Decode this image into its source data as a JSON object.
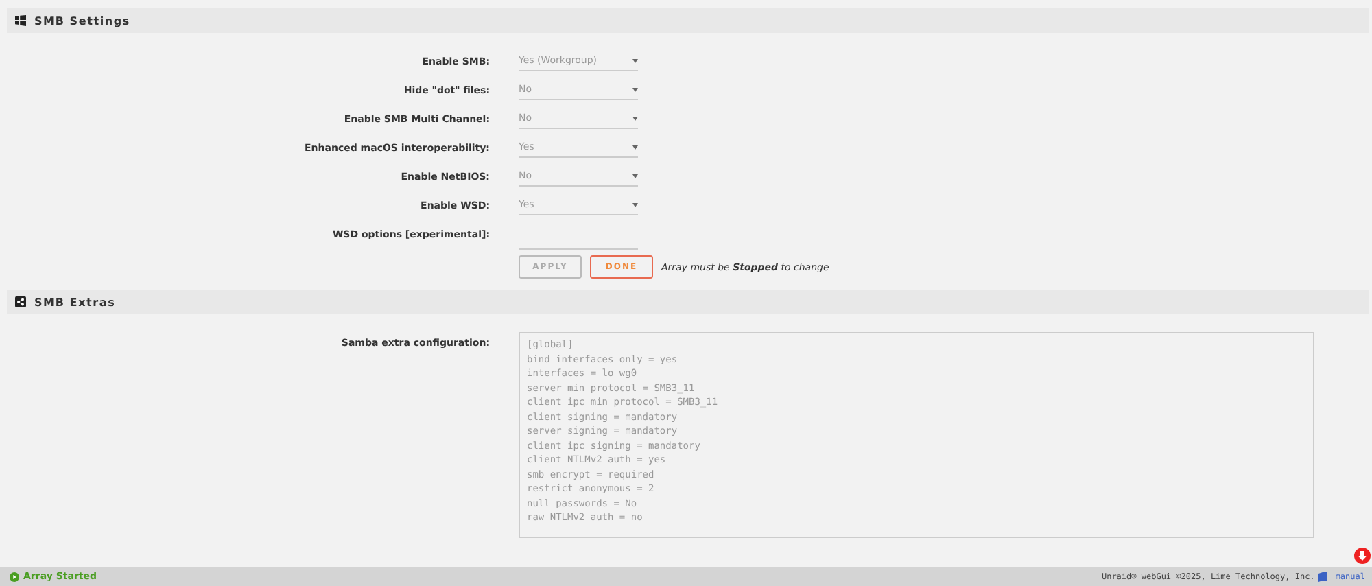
{
  "sections": [
    {
      "title": "SMB Settings",
      "fields": [
        {
          "kind": "select",
          "label": "Enable SMB:",
          "value": "Yes (Workgroup)",
          "disabled": true
        },
        {
          "kind": "select",
          "label": "Hide \"dot\" files:",
          "value": "No",
          "disabled": true
        },
        {
          "kind": "select",
          "label": "Enable SMB Multi Channel:",
          "value": "No",
          "disabled": true
        },
        {
          "kind": "select",
          "label": "Enhanced macOS interoperability:",
          "value": "Yes",
          "disabled": true
        },
        {
          "kind": "select",
          "label": "Enable NetBIOS:",
          "value": "No",
          "disabled": true
        },
        {
          "kind": "select",
          "label": "Enable WSD:",
          "value": "Yes",
          "disabled": true
        },
        {
          "kind": "text",
          "label": "WSD options [experimental]:",
          "disabled": true
        }
      ],
      "buttons": [
        {
          "label": "APPLY",
          "disabled": true
        },
        {
          "label": "DONE",
          "disabled": false
        }
      ],
      "note": "Array must be **Stopped** to change"
    },
    {
      "title": "SMB Extras",
      "fields": [
        {
          "kind": "textarea",
          "label": "Samba extra configuration:",
          "disabled": true,
          "lines": [
            "[global]",
            "bind interfaces only = yes",
            "interfaces = lo wg0",
            "server min protocol = SMB3_11",
            "client ipc min protocol = SMB3_11",
            "client signing = mandatory",
            "server signing = mandatory",
            "client ipc signing = mandatory",
            "client NTLMv2 auth = yes",
            "smb encrypt = required",
            "restrict anonymous = 2",
            "null passwords = No",
            "raw NTLMv2 auth = no"
          ]
        }
      ]
    }
  ],
  "status_bar": {
    "status": "Array Started",
    "started": true,
    "copyright": "Unraid® webGui ©2025, Lime Technology, Inc.",
    "link": "manual"
  }
}
